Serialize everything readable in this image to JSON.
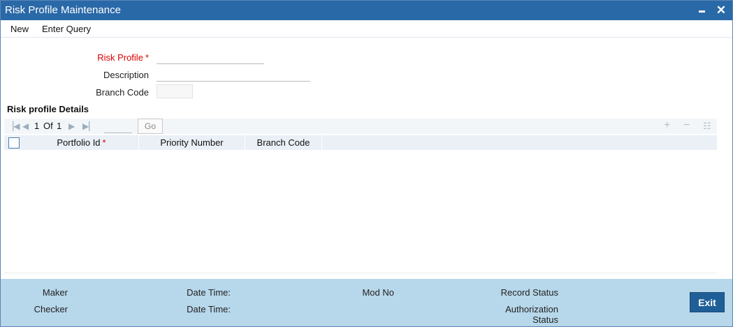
{
  "window": {
    "title": "Risk Profile Maintenance"
  },
  "menu": {
    "new": "New",
    "enter_query": "Enter Query"
  },
  "form": {
    "risk_profile": {
      "label": "Risk Profile",
      "required_mark": "*",
      "value": ""
    },
    "description": {
      "label": "Description",
      "value": ""
    },
    "branch_code": {
      "label": "Branch Code",
      "value": ""
    }
  },
  "details": {
    "title": "Risk profile Details",
    "pager": {
      "current": "1",
      "of_label": "Of",
      "total": "1",
      "go_label": "Go",
      "page_value": ""
    },
    "columns": {
      "portfolio_id": "Portfolio Id",
      "required_mark": "*",
      "priority_number": "Priority Number",
      "branch_code": "Branch Code"
    },
    "rows": []
  },
  "footer": {
    "maker": "Maker",
    "checker": "Checker",
    "date_time_1": "Date Time:",
    "date_time_2": "Date Time:",
    "mod_no": "Mod No",
    "record_status": "Record Status",
    "authorization_status_line1": "Authorization",
    "authorization_status_line2": "Status",
    "exit": "Exit"
  },
  "icons": {
    "first": "first-page-icon",
    "prev": "previous-page-icon",
    "next": "next-page-icon",
    "last": "last-page-icon",
    "add": "add-row-icon",
    "delete": "delete-row-icon",
    "single_view": "single-record-view-icon",
    "minimize": "minimize-icon",
    "close": "close-icon"
  },
  "colors": {
    "titlebar": "#2a69a8",
    "footer": "#b7d7ea",
    "required": "#dd0000",
    "exit_button": "#1f5f97"
  }
}
